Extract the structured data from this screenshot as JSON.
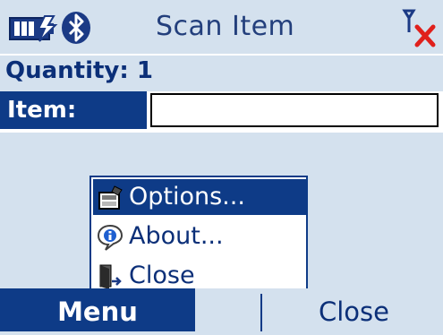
{
  "title": "Scan Item",
  "status": {
    "battery_icon": "battery-charging-icon",
    "bluetooth_icon": "bluetooth-icon",
    "signal_icon": "no-signal-icon"
  },
  "quantity": {
    "label": "Quantity:",
    "value": "1"
  },
  "item": {
    "label": "Item:",
    "value": ""
  },
  "menu": {
    "items": [
      {
        "label": "Options...",
        "icon": "options-icon",
        "selected": true
      },
      {
        "label": "About...",
        "icon": "about-icon",
        "selected": false
      },
      {
        "label": "Close",
        "icon": "close-door-icon",
        "selected": false
      }
    ]
  },
  "softkeys": {
    "left": "Menu",
    "right": "Close"
  },
  "colors": {
    "accent": "#0e3b87",
    "background": "#d4e1ee",
    "error": "#e0201c"
  }
}
